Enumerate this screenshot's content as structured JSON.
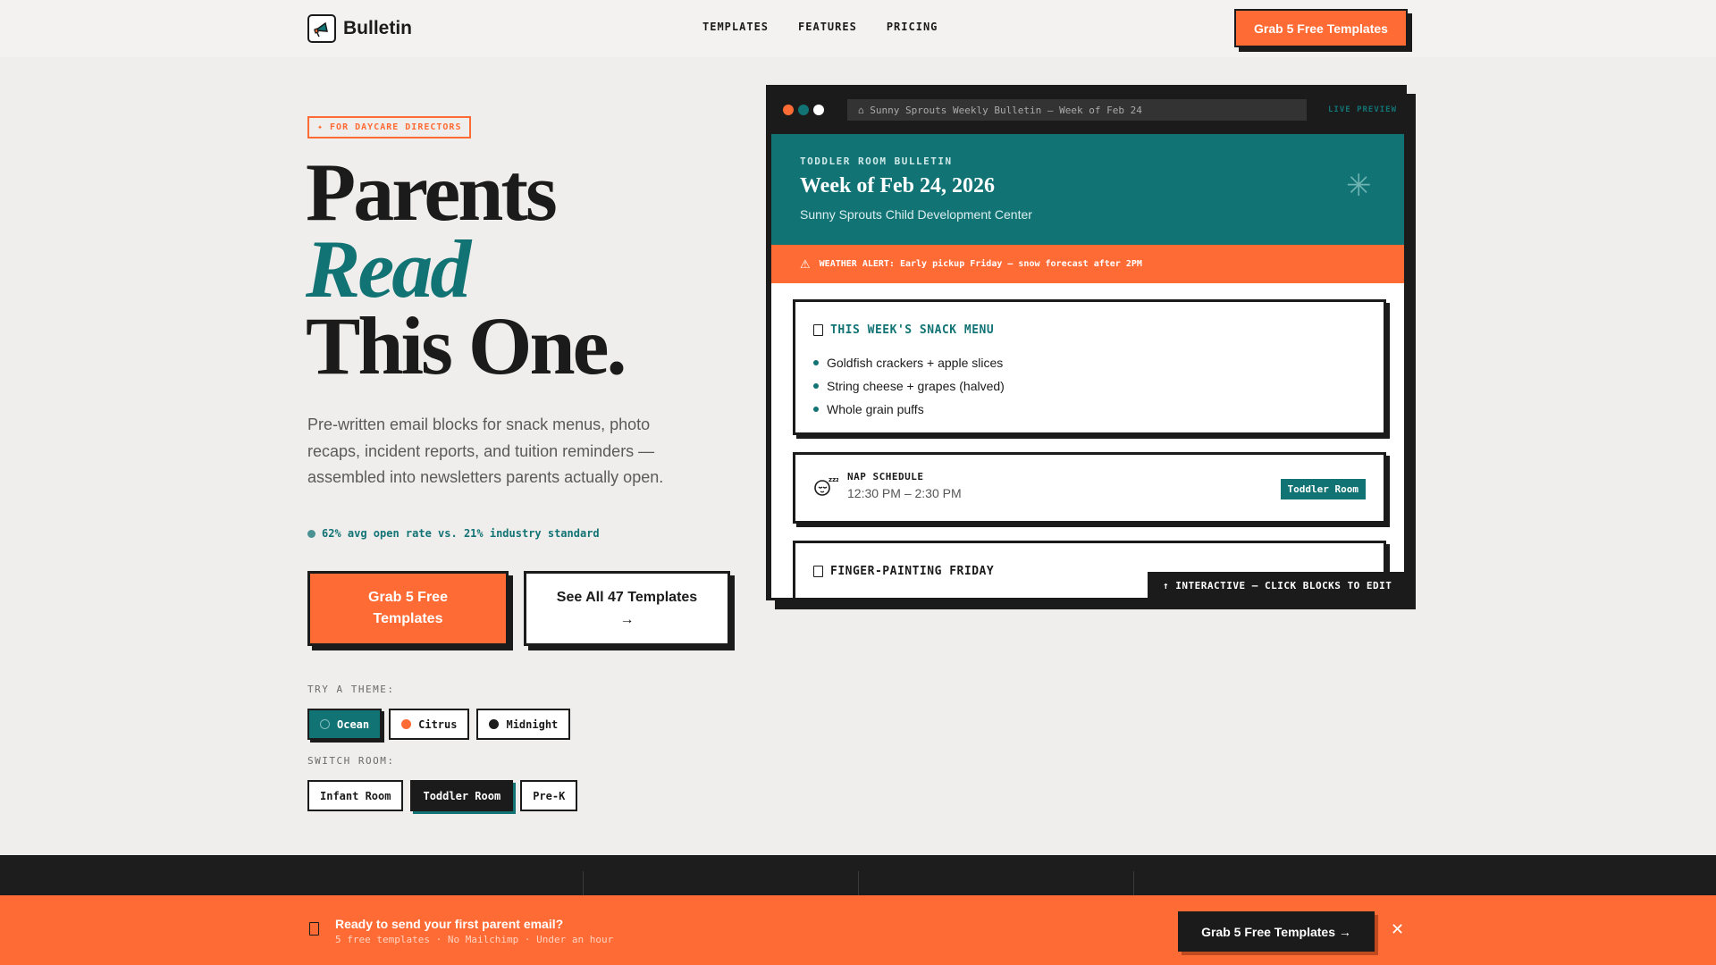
{
  "nav": {
    "brand": "Bulletin",
    "links": [
      "TEMPLATES",
      "FEATURES",
      "PRICING"
    ],
    "cta": "Grab 5 Free Templates"
  },
  "hero": {
    "badge": "✦ FOR DAYCARE DIRECTORS",
    "headline_line1": "Parents",
    "headline_line2": "Read",
    "headline_line3": "This One.",
    "subtitle": "Pre-written email blocks for snack menus, photo recaps, incident reports, and tuition reminders — assembled into newsletters parents actually open.",
    "stat": "62% avg open rate vs. 21% industry standard",
    "primary_cta": "Grab 5 Free Templates",
    "secondary_cta_line1": "See All 47 Templates",
    "secondary_cta_arrow": "→",
    "theme_label": "TRY A THEME:",
    "themes": [
      {
        "label": "Ocean",
        "color": "#127375",
        "active": true
      },
      {
        "label": "Citrus",
        "color": "#ff6b35",
        "active": false
      },
      {
        "label": "Midnight",
        "color": "#1b1b1b",
        "active": false
      }
    ],
    "room_label": "SWITCH ROOM:",
    "rooms": [
      {
        "label": "Infant Room",
        "active": false
      },
      {
        "label": "Toddler Room",
        "active": true
      },
      {
        "label": "Pre-K",
        "active": false
      }
    ]
  },
  "preview": {
    "url": "⌂ Sunny Sprouts Weekly Bulletin — Week of Feb 24",
    "live": "LIVE PREVIEW",
    "kicker": "TODDLER ROOM BULLETIN",
    "title": "Week of Feb 24, 2026",
    "org": "Sunny Sprouts Child Development Center",
    "alert": "WEATHER ALERT: Early pickup Friday — snow forecast after 2PM",
    "snack_title": "THIS WEEK'S SNACK MENU",
    "snacks": [
      "Goldfish crackers + apple slices",
      "String cheese + grapes (halved)",
      "Whole grain puffs"
    ],
    "nap_label": "NAP SCHEDULE",
    "nap_time": "12:30 PM – 2:30 PM",
    "nap_tag": "Toddler Room",
    "finger_title": "FINGER-PAINTING FRIDAY",
    "tip": "↑ INTERACTIVE — CLICK BLOCKS TO EDIT"
  },
  "sticky": {
    "title": "Ready to send your first parent email?",
    "sub": "5 free templates · No Mailchimp · Under an hour",
    "cta": "Grab 5 Free Templates →",
    "close": "✕"
  },
  "colors": {
    "accent": "#ff6b35",
    "teal": "#127375",
    "ink": "#1b1b1b",
    "background": "#efeeec"
  }
}
